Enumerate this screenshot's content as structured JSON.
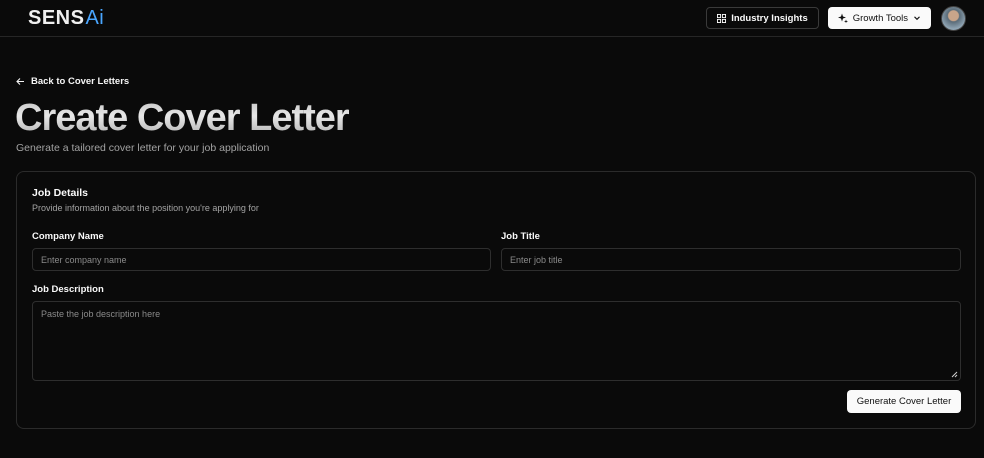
{
  "navbar": {
    "logo_main": "SENS",
    "logo_ai": "Ai",
    "industry_insights_label": "Industry Insights",
    "growth_tools_label": "Growth Tools"
  },
  "page": {
    "back_link": "Back to Cover Letters",
    "title": "Create Cover Letter",
    "subtitle": "Generate a tailored cover letter for your job application"
  },
  "card": {
    "title": "Job Details",
    "description": "Provide information about the position you're applying for",
    "company_label": "Company Name",
    "company_placeholder": "Enter company name",
    "job_title_label": "Job Title",
    "job_title_placeholder": "Enter job title",
    "job_description_label": "Job Description",
    "job_description_placeholder": "Paste the job description here",
    "generate_button": "Generate Cover Letter"
  }
}
